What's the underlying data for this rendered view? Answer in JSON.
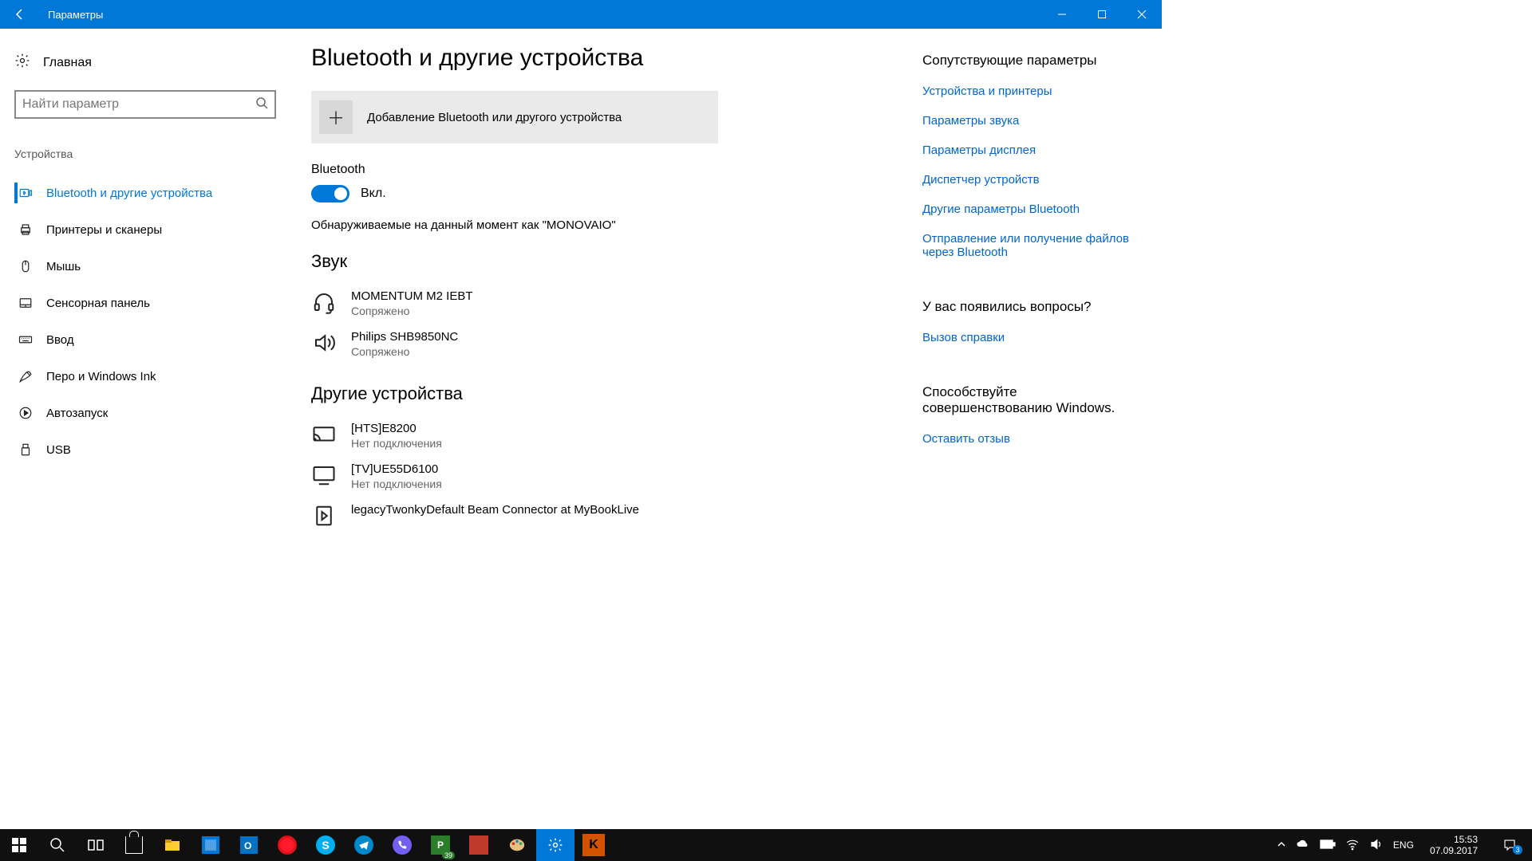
{
  "window": {
    "title": "Параметры"
  },
  "sidebar": {
    "home": "Главная",
    "search_placeholder": "Найти параметр",
    "group": "Устройства",
    "items": [
      {
        "label": "Bluetooth и другие устройства",
        "active": true
      },
      {
        "label": "Принтеры и сканеры"
      },
      {
        "label": "Мышь"
      },
      {
        "label": "Сенсорная панель"
      },
      {
        "label": "Ввод"
      },
      {
        "label": "Перо и Windows Ink"
      },
      {
        "label": "Автозапуск"
      },
      {
        "label": "USB"
      }
    ]
  },
  "main": {
    "title": "Bluetooth и другие устройства",
    "add_label": "Добавление Bluetooth или другого устройства",
    "bt_heading": "Bluetooth",
    "bt_toggle": "Вкл.",
    "discoverable": "Обнаруживаемые на данный момент как \"MONOVAIO\"",
    "audio_heading": "Звук",
    "audio": [
      {
        "name": "MOMENTUM M2 IEBT",
        "status": "Сопряжено"
      },
      {
        "name": "Philips SHB9850NC",
        "status": "Сопряжено"
      }
    ],
    "other_heading": "Другие устройства",
    "other": [
      {
        "name": "[HTS]E8200",
        "status": "Нет подключения"
      },
      {
        "name": "[TV]UE55D6100",
        "status": "Нет подключения"
      },
      {
        "name": "legacyTwonkyDefault Beam Connector at MyBookLive",
        "status": ""
      }
    ]
  },
  "related": {
    "heading1": "Сопутствующие параметры",
    "links1": [
      "Устройства и принтеры",
      "Параметры звука",
      "Параметры дисплея",
      "Диспетчер устройств",
      "Другие параметры Bluetooth",
      "Отправление или получение файлов через Bluetooth"
    ],
    "heading2": "У вас появились вопросы?",
    "links2": [
      "Вызов справки"
    ],
    "heading3_a": "Способствуйте",
    "heading3_b": "совершенствованию Windows.",
    "links3": [
      "Оставить отзыв"
    ]
  },
  "taskbar": {
    "lang": "ENG",
    "time": "15:53",
    "date": "07.09.2017",
    "pub_badge": "39",
    "notif_badge": "3"
  }
}
